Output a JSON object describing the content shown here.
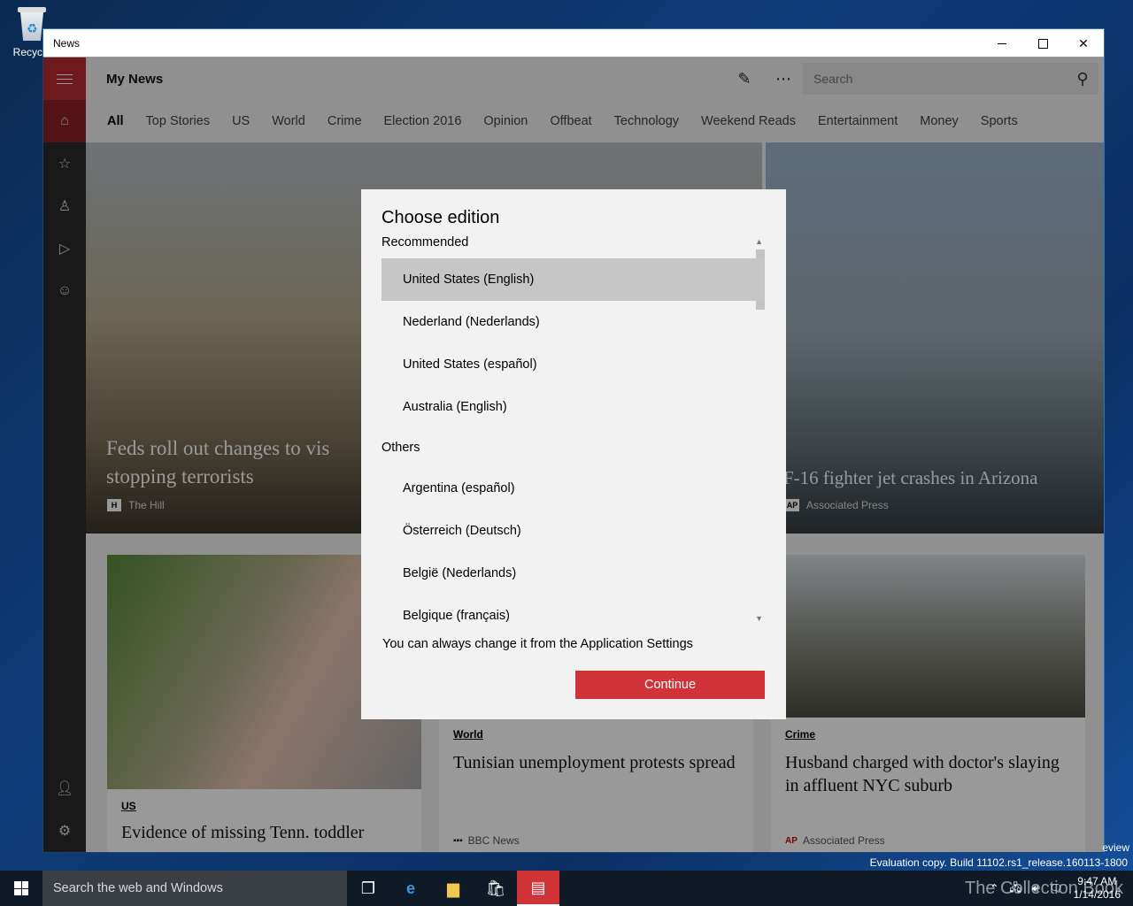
{
  "desktop": {
    "icon_label": "Recycle"
  },
  "window": {
    "title": "News"
  },
  "app": {
    "title": "My News",
    "search_placeholder": "Search",
    "tabs": [
      "All",
      "Top Stories",
      "US",
      "World",
      "Crime",
      "Election 2016",
      "Opinion",
      "Offbeat",
      "Technology",
      "Weekend Reads",
      "Entertainment",
      "Money",
      "Sports"
    ]
  },
  "hero": {
    "left_headline": "Feds roll out changes to visa, stopping terrorists",
    "left_headline_line1": "Feds roll out changes to vis",
    "left_headline_line2": "stopping terrorists",
    "left_source": "The Hill",
    "right_headline": "F-16 fighter jet crashes in Arizona",
    "right_source": "Associated Press"
  },
  "cards": [
    {
      "category": "US",
      "headline": "Evidence of missing Tenn. toddler"
    },
    {
      "category": "World",
      "headline": "Tunisian unemployment protests spread",
      "source": "BBC News"
    },
    {
      "category": "Crime",
      "headline": "Husband charged with doctor's slaying in affluent NYC suburb",
      "source": "Associated Press"
    }
  ],
  "dialog": {
    "title": "Choose edition",
    "recommended_label": "Recommended",
    "recommended": [
      "United States (English)",
      "Nederland (Nederlands)",
      "United States (español)",
      "Australia (English)"
    ],
    "others_label": "Others",
    "others": [
      "Argentina (español)",
      "Österreich (Deutsch)",
      "België (Nederlands)",
      "Belgique (français)"
    ],
    "note": "You can always change it from the Application Settings",
    "continue_label": "Continue"
  },
  "system": {
    "watermark": "Evaluation copy. Build 11102.rs1_release.160113-1800",
    "preview_text": "eview",
    "taskbar_search": "Search the web and Windows",
    "time": "9:47 AM",
    "date": "1/14/2016",
    "brand": "The Collection Book"
  },
  "colors": {
    "accent": "#d13438",
    "rail": "#2b2b2b",
    "taskbar": "#101a26"
  }
}
